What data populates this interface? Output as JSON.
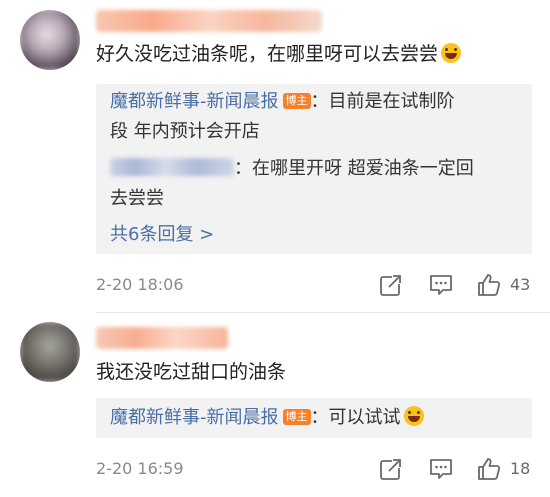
{
  "comments": [
    {
      "text": "好久没吃过油条呢，在哪里呀可以去尝尝",
      "emoji": "grinning-emoji",
      "replies": [
        {
          "author": "魔都新鲜事-新闻晨报",
          "badge": "博主",
          "text_line1": "：目前是在试制阶",
          "text_line2": "段 年内预计会开店"
        },
        {
          "author": "",
          "text_line1": "：在哪里开呀  超爱油条一定回",
          "text_line2": "去尝尝"
        }
      ],
      "more_replies": "共6条回复 >",
      "timestamp": "2-20 18:06",
      "likes": "43"
    },
    {
      "text": "我还没吃过甜口的油条",
      "replies": [
        {
          "author": "魔都新鲜事-新闻晨报",
          "badge": "博主",
          "text": "：可以试试",
          "emoji": "grinning-emoji"
        }
      ],
      "timestamp": "2-20 16:59",
      "likes": "18"
    }
  ],
  "colors": {
    "link": "#4a6fa5",
    "badge": "#f5822b",
    "reply_bg": "#f2f2f2",
    "meta_text": "#8a8a8a"
  },
  "icons": {
    "forward": "share-out-icon",
    "comment": "comment-bubble-icon",
    "like": "thumbs-up-icon"
  }
}
